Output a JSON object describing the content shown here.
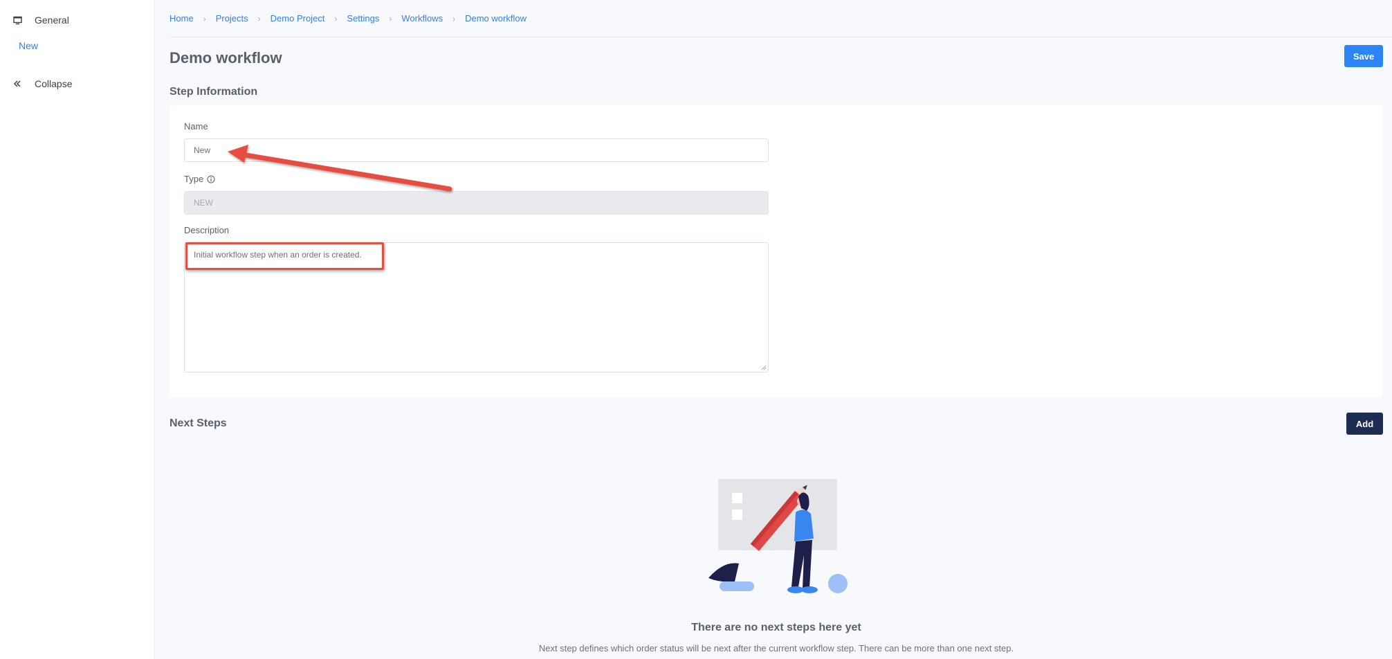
{
  "sidebar": {
    "general_label": "General",
    "sub_item": "New",
    "collapse_label": "Collapse"
  },
  "breadcrumb": [
    "Home",
    "Projects",
    "Demo Project",
    "Settings",
    "Workflows",
    "Demo workflow"
  ],
  "page_title": "Demo workflow",
  "save_label": "Save",
  "step_info": {
    "title": "Step Information",
    "name_label": "Name",
    "name_value": "New",
    "type_label": "Type",
    "type_value": "NEW",
    "description_label": "Description",
    "description_value": "Initial workflow step when an order is created."
  },
  "next_steps": {
    "title": "Next Steps",
    "add_label": "Add",
    "empty_title": "There are no next steps here yet",
    "empty_description": "Next step defines which order status will be next after the current workflow step. There can be more than one next step."
  },
  "colors": {
    "primary": "#2b85f5",
    "dark_button": "#1c2c52",
    "link": "#3b7ddd",
    "annotation": "#e64e3f"
  }
}
